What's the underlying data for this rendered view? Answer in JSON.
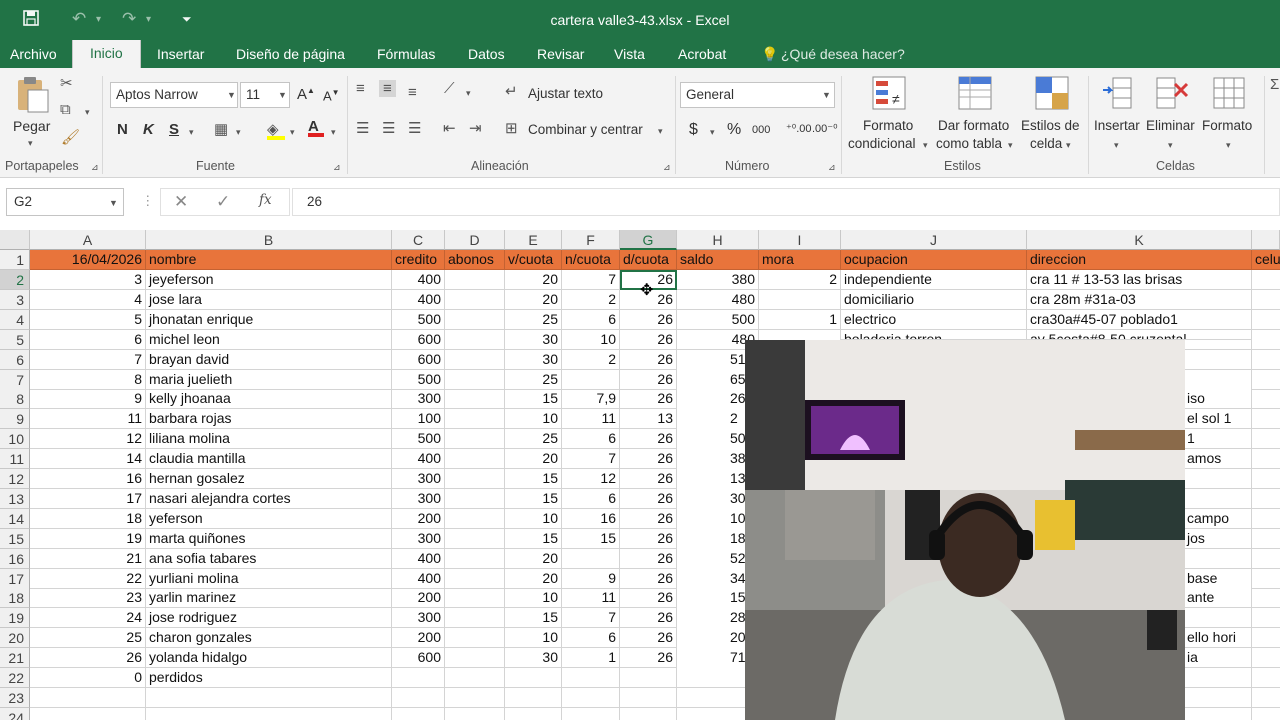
{
  "app": {
    "window_title": "cartera valle3-43.xlsx - Excel",
    "brand_color": "#217346",
    "header_fill_color": "#e8743b"
  },
  "quick_access": [
    {
      "name": "save-icon",
      "glyph": "🖫"
    },
    {
      "name": "undo-icon",
      "glyph": "↶"
    },
    {
      "name": "redo-icon",
      "glyph": "↷"
    },
    {
      "name": "customize-icon",
      "glyph": "⏷"
    }
  ],
  "tabs": [
    "Archivo",
    "Inicio",
    "Insertar",
    "Diseño de página",
    "Fórmulas",
    "Datos",
    "Revisar",
    "Vista",
    "Acrobat"
  ],
  "tell_me": "¿Qué desea hacer?",
  "ribbon": {
    "clipboard": {
      "paste": "Pegar",
      "label": "Portapapeles"
    },
    "font": {
      "name": "Aptos Narrow",
      "size": "11",
      "bold": "N",
      "italic": "K",
      "underline": "S",
      "label": "Fuente"
    },
    "alignment": {
      "wrap": "Ajustar texto",
      "merge": "Combinar y centrar",
      "label": "Alineación"
    },
    "number": {
      "format": "General",
      "currency": "$",
      "percent": "%",
      "thousands": "000",
      "label": "Número"
    },
    "styles": {
      "cond_format_1": "Formato",
      "cond_format_2": "condicional",
      "table_1": "Dar formato",
      "table_2": "como tabla",
      "cell_styles_1": "Estilos de",
      "cell_styles_2": "celda",
      "label": "Estilos"
    },
    "cells": {
      "insert": "Insertar",
      "delete": "Eliminar",
      "format": "Formato",
      "label": "Celdas"
    }
  },
  "formula_bar": {
    "name_box": "G2",
    "fx": "fx",
    "value": "26"
  },
  "columns": [
    "A",
    "B",
    "C",
    "D",
    "E",
    "F",
    "G",
    "H",
    "I",
    "J",
    "K"
  ],
  "headers": [
    "16/04/2026",
    "nombre",
    "credito",
    "abonos",
    "v/cuota",
    "n/cuota",
    "d/cuota",
    "saldo",
    "mora",
    "ocupacion",
    "direccion",
    "celu"
  ],
  "rows": [
    {
      "r": "2",
      "a": "3",
      "b": "jeyeferson",
      "c": "400",
      "d": "",
      "e": "20",
      "f": "7",
      "g": "26",
      "h": "380",
      "i": "2",
      "j": "independiente",
      "k": "cra 11 # 13-53 las brisas"
    },
    {
      "r": "3",
      "a": "4",
      "b": "jose lara",
      "c": "400",
      "d": "",
      "e": "20",
      "f": "2",
      "g": "26",
      "h": "480",
      "i": "",
      "j": "domiciliario",
      "k": "cra 28m #31a-03"
    },
    {
      "r": "4",
      "a": "5",
      "b": "jhonatan enrique",
      "c": "500",
      "d": "",
      "e": "25",
      "f": "6",
      "g": "26",
      "h": "500",
      "i": "1",
      "j": "electrico",
      "k": "cra30a#45-07 poblado1"
    },
    {
      "r": "5",
      "a": "6",
      "b": "michel leon",
      "c": "600",
      "d": "",
      "e": "30",
      "f": "10",
      "g": "26",
      "h": "480",
      "i": "",
      "j": "",
      "k": ""
    },
    {
      "r": "6",
      "a": "7",
      "b": "brayan david",
      "c": "600",
      "d": "",
      "e": "30",
      "f": "2",
      "g": "26",
      "h": "",
      "i": "",
      "j": "",
      "k": ""
    },
    {
      "r": "7",
      "a": "8",
      "b": "maria juelieth",
      "c": "500",
      "d": "",
      "e": "25",
      "f": "",
      "g": "26",
      "h": "",
      "i": "",
      "j": "",
      "k": ""
    },
    {
      "r": "8",
      "a": "9",
      "b": "kelly jhoanaa",
      "c": "300",
      "d": "",
      "e": "15",
      "f": "7,9",
      "g": "26",
      "h": "",
      "i": "",
      "j": "",
      "k": ""
    },
    {
      "r": "9",
      "a": "11",
      "b": "barbara rojas",
      "c": "100",
      "d": "",
      "e": "10",
      "f": "11",
      "g": "13",
      "h": "",
      "i": "",
      "j": "",
      "k": ""
    },
    {
      "r": "10",
      "a": "12",
      "b": "liliana molina",
      "c": "500",
      "d": "",
      "e": "25",
      "f": "6",
      "g": "26",
      "h": "",
      "i": "",
      "j": "",
      "k": ""
    },
    {
      "r": "11",
      "a": "14",
      "b": "claudia mantilla",
      "c": "400",
      "d": "",
      "e": "20",
      "f": "7",
      "g": "26",
      "h": "",
      "i": "",
      "j": "",
      "k": ""
    },
    {
      "r": "12",
      "a": "16",
      "b": "hernan gosalez",
      "c": "300",
      "d": "",
      "e": "15",
      "f": "12",
      "g": "26",
      "h": "",
      "i": "",
      "j": "",
      "k": ""
    },
    {
      "r": "13",
      "a": "17",
      "b": "nasari alejandra cortes",
      "c": "300",
      "d": "",
      "e": "15",
      "f": "6",
      "g": "26",
      "h": "",
      "i": "",
      "j": "",
      "k": ""
    },
    {
      "r": "14",
      "a": "18",
      "b": "yeferson",
      "c": "200",
      "d": "",
      "e": "10",
      "f": "16",
      "g": "26",
      "h": "",
      "i": "",
      "j": "",
      "k": ""
    },
    {
      "r": "15",
      "a": "19",
      "b": "marta quiñones",
      "c": "300",
      "d": "",
      "e": "15",
      "f": "15",
      "g": "26",
      "h": "",
      "i": "",
      "j": "",
      "k": ""
    },
    {
      "r": "16",
      "a": "21",
      "b": "ana sofia tabares",
      "c": "400",
      "d": "",
      "e": "20",
      "f": "",
      "g": "26",
      "h": "",
      "i": "",
      "j": "",
      "k": ""
    },
    {
      "r": "17",
      "a": "22",
      "b": "yurliani molina",
      "c": "400",
      "d": "",
      "e": "20",
      "f": "9",
      "g": "26",
      "h": "",
      "i": "",
      "j": "",
      "k": ""
    },
    {
      "r": "18",
      "a": "23",
      "b": "yarlin marinez",
      "c": "200",
      "d": "",
      "e": "10",
      "f": "11",
      "g": "26",
      "h": "",
      "i": "",
      "j": "",
      "k": ""
    },
    {
      "r": "19",
      "a": "24",
      "b": "jose rodriguez",
      "c": "300",
      "d": "",
      "e": "15",
      "f": "7",
      "g": "26",
      "h": "",
      "i": "",
      "j": "",
      "k": ""
    },
    {
      "r": "20",
      "a": "25",
      "b": "charon gonzales",
      "c": "200",
      "d": "",
      "e": "10",
      "f": "6",
      "g": "26",
      "h": "",
      "i": "",
      "j": "",
      "k": ""
    },
    {
      "r": "21",
      "a": "26",
      "b": "yolanda hidalgo",
      "c": "600",
      "d": "",
      "e": "30",
      "f": "1",
      "g": "26",
      "h": "",
      "i": "",
      "j": "",
      "k": ""
    },
    {
      "r": "22",
      "a": "0",
      "b": "perdidos",
      "c": "",
      "d": "",
      "e": "",
      "f": "",
      "g": "",
      "h": "",
      "i": "",
      "j": "",
      "k": ""
    },
    {
      "r": "23",
      "a": "",
      "b": "",
      "c": "",
      "d": "",
      "e": "",
      "f": "",
      "g": "",
      "h": "",
      "i": "",
      "j": "",
      "k": ""
    },
    {
      "r": "24",
      "a": "",
      "b": "",
      "c": "",
      "d": "",
      "e": "",
      "f": "",
      "g": "",
      "h": "",
      "i": "",
      "j": "",
      "k": ""
    }
  ],
  "partial_texts": {
    "saldo": [
      "",
      "",
      "",
      "",
      "51",
      "65",
      "26",
      "2",
      "50",
      "38",
      "13",
      "30",
      "10",
      "18",
      "52",
      "34",
      "15",
      "28",
      "20",
      "71"
    ],
    "j5": "boladeria torren",
    "k5": "av 5costa#8-50 cruzental",
    "k_right": [
      "",
      "",
      "",
      "",
      "",
      "",
      "iso",
      "el sol 1",
      "1",
      "amos",
      "",
      "",
      "campo",
      "jos",
      "",
      "base",
      "ante",
      "",
      "ello hori",
      "ia"
    ]
  },
  "webcam": {
    "label": "webcam-overlay"
  }
}
